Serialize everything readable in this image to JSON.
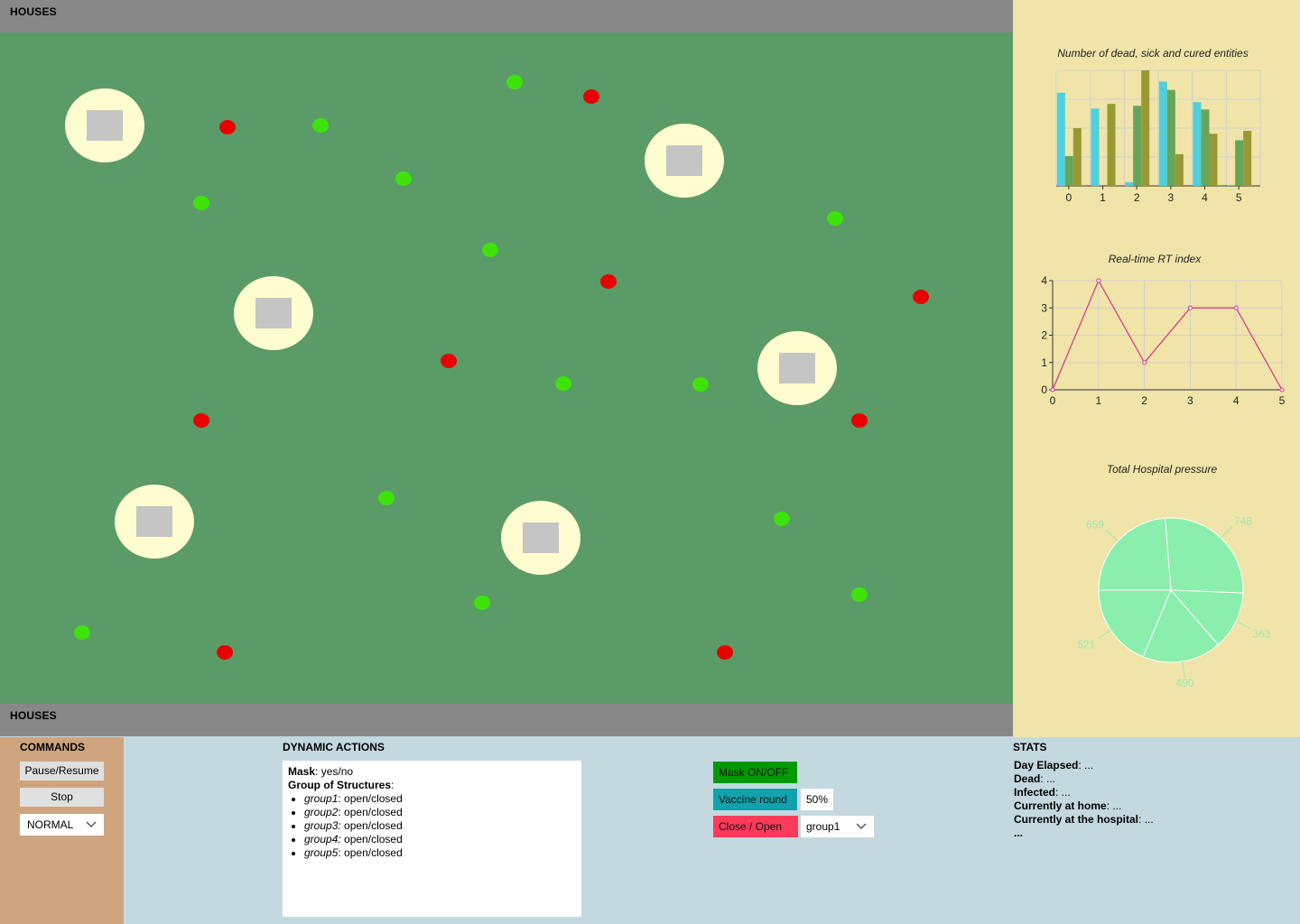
{
  "top_bar": {
    "title": "HOUSES"
  },
  "bottom_bar": {
    "title": "HOUSES"
  },
  "simulation": {
    "structures": 6,
    "entity_colors": {
      "healthy": "#3ee30a",
      "sick": "#e80000"
    }
  },
  "charts_panel": {
    "bar_title": "Number of dead, sick and cured entities",
    "line_title": "Real-time RT index",
    "pie_title": "Total Hospital pressure"
  },
  "chart_data": [
    {
      "type": "bar",
      "title": "Number of dead, sick and cured entities",
      "categories": [
        "0",
        "1",
        "2",
        "3",
        "4",
        "5"
      ],
      "series": [
        {
          "color": "#4ed1dc",
          "values": [
            100,
            83,
            4,
            112,
            90,
            1
          ]
        },
        {
          "color": "#66a55a",
          "values": [
            32,
            1,
            86,
            103,
            82,
            49
          ]
        },
        {
          "color": "#999933",
          "values": [
            62,
            88,
            124,
            34,
            56,
            59
          ]
        }
      ],
      "ylim": [
        0,
        124
      ],
      "grid": true
    },
    {
      "type": "line",
      "title": "Real-time RT index",
      "x": [
        0,
        1,
        2,
        3,
        4,
        5
      ],
      "y": [
        0,
        4,
        1,
        3,
        3,
        0
      ],
      "xticks": [
        "0",
        "1",
        "2",
        "3",
        "4",
        "5"
      ],
      "yticks": [
        "0",
        "1",
        "2",
        "3",
        "4"
      ],
      "ylim": [
        0,
        4
      ],
      "color": "#d63384",
      "grid": true
    },
    {
      "type": "pie",
      "title": "Total Hospital pressure",
      "values": [
        748,
        363,
        490,
        521,
        659
      ],
      "labels": [
        "748",
        "363",
        "490",
        "521",
        "659"
      ],
      "color": "#8aefac",
      "label_color": "#9ee8b0"
    }
  ],
  "commands": {
    "title": "COMMANDS",
    "pause_label": "Pause/Resume",
    "stop_label": "Stop",
    "speed_value": "NORMAL"
  },
  "dynamic_actions": {
    "title": "DYNAMIC ACTIONS",
    "mask_key": "Mask",
    "mask_value": ": yes/no",
    "groups_key": "Group of Structures",
    "groups_colon": ":",
    "groups": [
      {
        "name": "group1",
        "status": ": open/closed"
      },
      {
        "name": "group2",
        "status": ": open/closed"
      },
      {
        "name": "group3:",
        "status": " open/closed"
      },
      {
        "name": "group4:",
        "status": " open/closed"
      },
      {
        "name": "group5",
        "status": ": open/closed"
      }
    ],
    "mask_button": "Mask ON/OFF",
    "mask_color": "#009a00",
    "vaccine_button": "Vaccine round",
    "vaccine_color": "#11a2ab",
    "vaccine_percent": "50%",
    "close_button": "Close / Open",
    "close_color": "#fe3a5b",
    "group_select": "group1"
  },
  "stats": {
    "title": "STATS",
    "items": [
      {
        "label": "Day Elapsed",
        "value": ": ..."
      },
      {
        "label": "Dead",
        "value": ": ..."
      },
      {
        "label": "Infected",
        "value": ": ..."
      },
      {
        "label": "Currently at home",
        "value": ": ..."
      },
      {
        "label": "Currently at the hospital",
        "value": ": ..."
      },
      {
        "label": "...",
        "value": ""
      }
    ]
  }
}
